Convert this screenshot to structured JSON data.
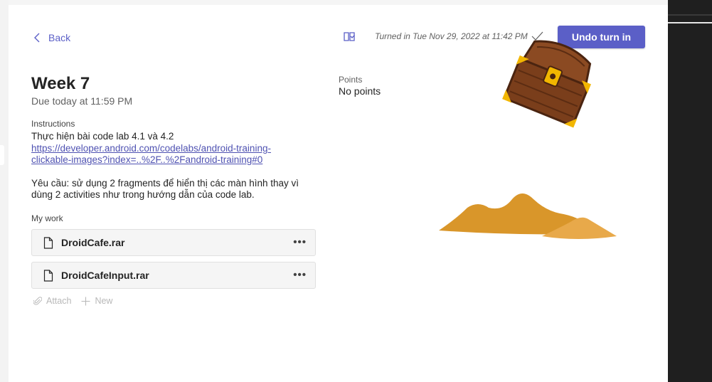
{
  "nav": {
    "back_label": "Back"
  },
  "assignment": {
    "title": "Week 7",
    "due": "Due today at 11:59 PM",
    "instructions_label": "Instructions",
    "instructions_line1": "Thực hiện bài code lab 4.1 và 4.2",
    "instructions_link_line1": "https://developer.android.com/codelabs/android-training-",
    "instructions_link_line2": "clickable-images?index=..%2F..%2Fandroid-training#0",
    "instructions_line3": "Yêu cầu: sử dụng 2 fragments để hiển thị các màn hình thay vì",
    "instructions_line4": "dùng 2 activities như trong hướng dẫn của code lab."
  },
  "my_work": {
    "label": "My work",
    "files": [
      {
        "name": "DroidCafe.rar",
        "more": "•••"
      },
      {
        "name": "DroidCafeInput.rar",
        "more": "•••"
      }
    ],
    "attach_label": "Attach",
    "new_label": "New"
  },
  "status": {
    "turned_in": "Turned in Tue Nov 29, 2022 at 11:42 PM",
    "undo_label": "Undo turn in"
  },
  "points": {
    "label": "Points",
    "value": "No points"
  },
  "colors": {
    "accent": "#5b5fc7",
    "link": "#4f52b2",
    "sand": "#d9962a",
    "sand_light": "#e8a94a",
    "chest_wood": "#8b4a22",
    "chest_gold": "#f2b600"
  },
  "icons": [
    "chevron-left-icon",
    "immersive-reader-icon",
    "checkmark-icon",
    "file-icon",
    "more-icon",
    "paperclip-icon",
    "plus-icon"
  ]
}
